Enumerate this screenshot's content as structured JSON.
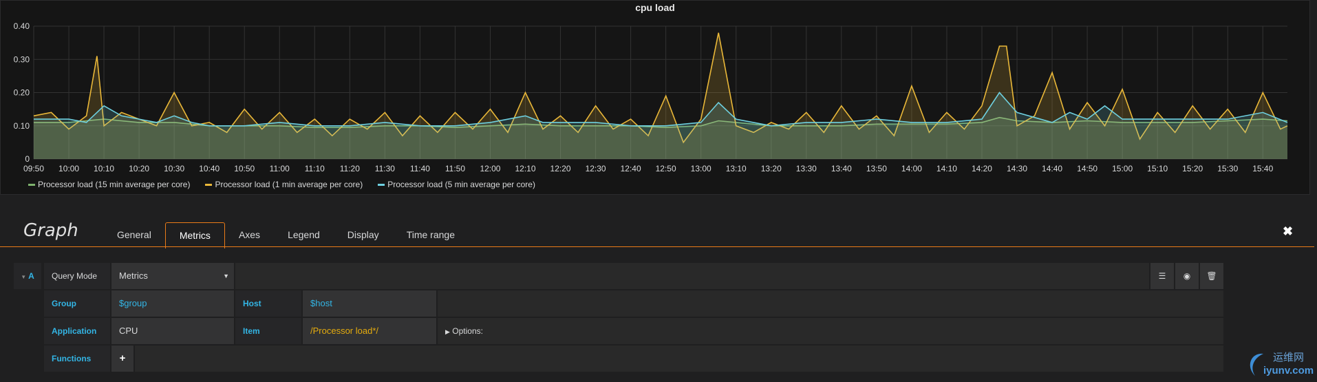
{
  "chart_data": {
    "type": "line",
    "title": "cpu load",
    "xlabel": "",
    "ylabel": "",
    "x_ticks": [
      "09:50",
      "10:00",
      "10:10",
      "10:20",
      "10:30",
      "10:40",
      "10:50",
      "11:00",
      "11:10",
      "11:20",
      "11:30",
      "11:40",
      "11:50",
      "12:00",
      "12:10",
      "12:20",
      "12:30",
      "12:40",
      "12:50",
      "13:00",
      "13:10",
      "13:20",
      "13:30",
      "13:40",
      "13:50",
      "14:00",
      "14:10",
      "14:20",
      "14:30",
      "14:40",
      "14:50",
      "15:00",
      "15:10",
      "15:20",
      "15:30",
      "15:40"
    ],
    "y_ticks": [
      "0",
      "0.10",
      "0.20",
      "0.30",
      "0.40"
    ],
    "ylim": [
      0,
      0.4
    ],
    "x_start": "09:50",
    "x_end": "15:47",
    "grid": true,
    "legend_position": "bottom-left",
    "series": [
      {
        "name": "Processor load (15 min average per core)",
        "color": "#7eb26d",
        "x": [
          "09:50",
          "10:00",
          "10:10",
          "10:20",
          "10:30",
          "10:40",
          "10:50",
          "11:00",
          "11:10",
          "11:20",
          "11:30",
          "11:40",
          "11:50",
          "12:00",
          "12:10",
          "12:20",
          "12:30",
          "12:40",
          "12:50",
          "13:00",
          "13:05",
          "13:10",
          "13:20",
          "13:30",
          "13:40",
          "13:50",
          "14:00",
          "14:10",
          "14:20",
          "14:25",
          "14:30",
          "14:40",
          "14:50",
          "15:00",
          "15:10",
          "15:20",
          "15:30",
          "15:40",
          "15:47"
        ],
        "values": [
          0.11,
          0.11,
          0.12,
          0.11,
          0.11,
          0.1,
          0.1,
          0.1,
          0.095,
          0.095,
          0.1,
          0.1,
          0.095,
          0.1,
          0.105,
          0.1,
          0.1,
          0.1,
          0.095,
          0.1,
          0.115,
          0.11,
          0.1,
          0.1,
          0.1,
          0.105,
          0.105,
          0.105,
          0.11,
          0.125,
          0.115,
          0.11,
          0.115,
          0.11,
          0.11,
          0.11,
          0.115,
          0.12,
          0.115
        ]
      },
      {
        "name": "Processor load (1 min average per core)",
        "color": "#eab839",
        "x": [
          "09:50",
          "09:55",
          "10:00",
          "10:05",
          "10:08",
          "10:10",
          "10:15",
          "10:20",
          "10:25",
          "10:30",
          "10:35",
          "10:40",
          "10:45",
          "10:50",
          "10:55",
          "11:00",
          "11:05",
          "11:10",
          "11:15",
          "11:20",
          "11:25",
          "11:30",
          "11:35",
          "11:40",
          "11:45",
          "11:50",
          "11:55",
          "12:00",
          "12:05",
          "12:10",
          "12:15",
          "12:20",
          "12:25",
          "12:30",
          "12:35",
          "12:40",
          "12:45",
          "12:50",
          "12:55",
          "13:00",
          "13:05",
          "13:10",
          "13:15",
          "13:20",
          "13:25",
          "13:30",
          "13:35",
          "13:40",
          "13:45",
          "13:50",
          "13:55",
          "14:00",
          "14:05",
          "14:10",
          "14:15",
          "14:20",
          "14:25",
          "14:27",
          "14:30",
          "14:35",
          "14:40",
          "14:45",
          "14:50",
          "14:55",
          "15:00",
          "15:05",
          "15:10",
          "15:15",
          "15:20",
          "15:25",
          "15:30",
          "15:35",
          "15:40",
          "15:45",
          "15:47"
        ],
        "values": [
          0.13,
          0.14,
          0.09,
          0.13,
          0.31,
          0.1,
          0.14,
          0.12,
          0.1,
          0.2,
          0.1,
          0.11,
          0.08,
          0.15,
          0.09,
          0.14,
          0.08,
          0.12,
          0.07,
          0.12,
          0.09,
          0.14,
          0.07,
          0.13,
          0.08,
          0.14,
          0.09,
          0.15,
          0.08,
          0.2,
          0.09,
          0.13,
          0.08,
          0.16,
          0.09,
          0.12,
          0.07,
          0.19,
          0.05,
          0.12,
          0.38,
          0.1,
          0.08,
          0.11,
          0.09,
          0.14,
          0.08,
          0.16,
          0.09,
          0.13,
          0.07,
          0.22,
          0.08,
          0.14,
          0.09,
          0.16,
          0.34,
          0.34,
          0.1,
          0.13,
          0.26,
          0.09,
          0.17,
          0.1,
          0.21,
          0.06,
          0.14,
          0.08,
          0.16,
          0.09,
          0.15,
          0.08,
          0.2,
          0.09,
          0.1
        ]
      },
      {
        "name": "Processor load (5 min average per core)",
        "color": "#6ed0e0",
        "x": [
          "09:50",
          "10:00",
          "10:05",
          "10:10",
          "10:15",
          "10:20",
          "10:25",
          "10:30",
          "10:35",
          "10:40",
          "10:50",
          "11:00",
          "11:10",
          "11:20",
          "11:30",
          "11:40",
          "11:50",
          "12:00",
          "12:10",
          "12:15",
          "12:20",
          "12:30",
          "12:40",
          "12:50",
          "13:00",
          "13:05",
          "13:10",
          "13:20",
          "13:30",
          "13:40",
          "13:50",
          "14:00",
          "14:10",
          "14:20",
          "14:25",
          "14:30",
          "14:40",
          "14:45",
          "14:50",
          "14:55",
          "15:00",
          "15:10",
          "15:20",
          "15:30",
          "15:40",
          "15:47"
        ],
        "values": [
          0.12,
          0.12,
          0.11,
          0.16,
          0.13,
          0.12,
          0.11,
          0.13,
          0.11,
          0.1,
          0.1,
          0.11,
          0.1,
          0.1,
          0.11,
          0.1,
          0.1,
          0.11,
          0.13,
          0.11,
          0.11,
          0.11,
          0.1,
          0.1,
          0.11,
          0.17,
          0.12,
          0.1,
          0.11,
          0.11,
          0.12,
          0.11,
          0.11,
          0.12,
          0.2,
          0.14,
          0.11,
          0.14,
          0.12,
          0.16,
          0.12,
          0.12,
          0.12,
          0.12,
          0.14,
          0.11
        ]
      }
    ]
  },
  "editor": {
    "title": "Graph",
    "tabs": [
      {
        "label": "General"
      },
      {
        "label": "Metrics"
      },
      {
        "label": "Axes"
      },
      {
        "label": "Legend"
      },
      {
        "label": "Display"
      },
      {
        "label": "Time range"
      }
    ],
    "active_tab": "Metrics",
    "close_icon": "close-icon"
  },
  "query": {
    "ref": "A",
    "query_mode_label": "Query Mode",
    "query_mode_value": "Metrics",
    "group_label": "Group",
    "group_value": "$group",
    "host_label": "Host",
    "host_value": "$host",
    "application_label": "Application",
    "application_value": "CPU",
    "item_label": "Item",
    "item_value": "/Processor load*/",
    "options_label": "Options:",
    "functions_label": "Functions",
    "add_function": "+"
  },
  "watermark": {
    "line1": "运维网",
    "line2": "iyunv.com"
  }
}
